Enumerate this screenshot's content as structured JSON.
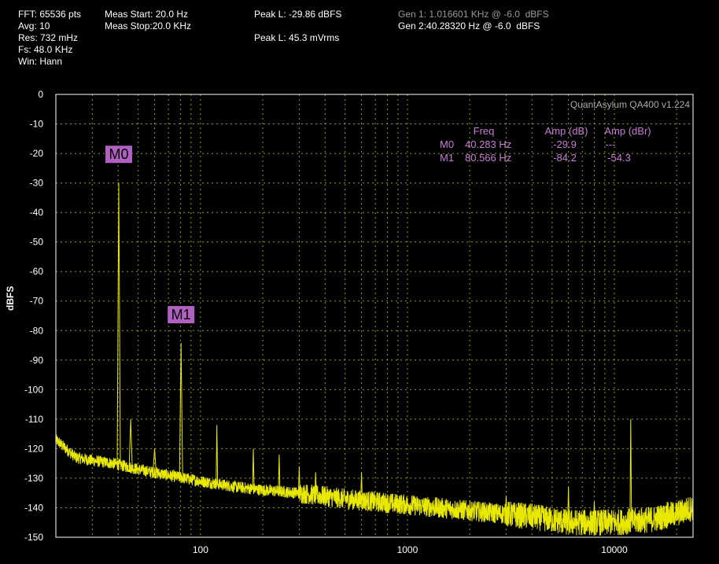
{
  "header": {
    "fft": "FFT: 65536 pts",
    "avg": "Avg: 10",
    "res": "Res: 732 mHz",
    "fs": "Fs: 48.0 KHz",
    "win": "Win: Hann",
    "meas_start": "Meas Start: 20.0 Hz",
    "meas_stop": "Meas Stop:20.0 KHz",
    "peak_l_dbfs": "Peak L: -29.86 dBFS",
    "peak_l_vrms": "Peak L: 45.3 mVrms",
    "gen1": "Gen 1: 1.016601 KHz @ -6.0  dBFS",
    "gen2": "Gen 2:40.28320 Hz @ -6.0  dBFS"
  },
  "plot": {
    "watermark": "QuantAsylum QA400 v1.224",
    "ylabel": "dBFS",
    "colors": {
      "trace": "#e8e800",
      "marker": "#c77dd6",
      "marker_box": "#b060c0",
      "grid": "#cccc00",
      "frame": "#ffffff"
    }
  },
  "marker_table": {
    "headers": [
      "Freq",
      "Amp (dB)",
      "Amp (dBr)"
    ],
    "rows": [
      {
        "id": "M0",
        "freq": "40.283 Hz",
        "amp_db": "-29.9",
        "amp_dbr": "---"
      },
      {
        "id": "M1",
        "freq": "80.566 Hz",
        "amp_db": "-84.2",
        "amp_dbr": "-54.3"
      }
    ]
  },
  "markers": [
    {
      "label": "M0",
      "freq_hz": 40.283,
      "amp_db": -29.9
    },
    {
      "label": "M1",
      "freq_hz": 80.566,
      "amp_db": -84.2
    }
  ],
  "chart_data": {
    "type": "line",
    "xscale": "log",
    "xlim": [
      20,
      24000
    ],
    "ylim": [
      -150,
      0
    ],
    "xticks": [
      100,
      1000,
      10000
    ],
    "xtick_labels": [
      "100",
      "1000",
      "10000"
    ],
    "yticks": [
      0,
      -10,
      -20,
      -30,
      -40,
      -50,
      -60,
      -70,
      -80,
      -90,
      -100,
      -110,
      -120,
      -130,
      -140,
      -150
    ],
    "ylabel": "dBFS",
    "grid": true,
    "noise_floor": [
      [
        20,
        -117
      ],
      [
        25,
        -123
      ],
      [
        30,
        -124
      ],
      [
        38,
        -125
      ],
      [
        50,
        -127
      ],
      [
        70,
        -129
      ],
      [
        100,
        -131
      ],
      [
        150,
        -133
      ],
      [
        200,
        -134
      ],
      [
        300,
        -135
      ],
      [
        500,
        -137
      ],
      [
        1000,
        -139
      ],
      [
        2000,
        -141
      ],
      [
        4000,
        -143
      ],
      [
        6000,
        -145
      ],
      [
        10000,
        -145
      ],
      [
        15000,
        -144
      ],
      [
        20000,
        -142
      ],
      [
        24000,
        -140
      ]
    ],
    "peaks": [
      [
        40.283,
        -29.9
      ],
      [
        46,
        -110
      ],
      [
        60,
        -120
      ],
      [
        80.566,
        -84.2
      ],
      [
        120,
        -112
      ],
      [
        180,
        -120
      ],
      [
        240,
        -122
      ],
      [
        300,
        -126
      ],
      [
        360,
        -128
      ],
      [
        400,
        -133
      ],
      [
        600,
        -128
      ],
      [
        3000,
        -136
      ],
      [
        6000,
        -133
      ],
      [
        8000,
        -138
      ],
      [
        12000,
        -110
      ],
      [
        18000,
        -138
      ]
    ]
  }
}
